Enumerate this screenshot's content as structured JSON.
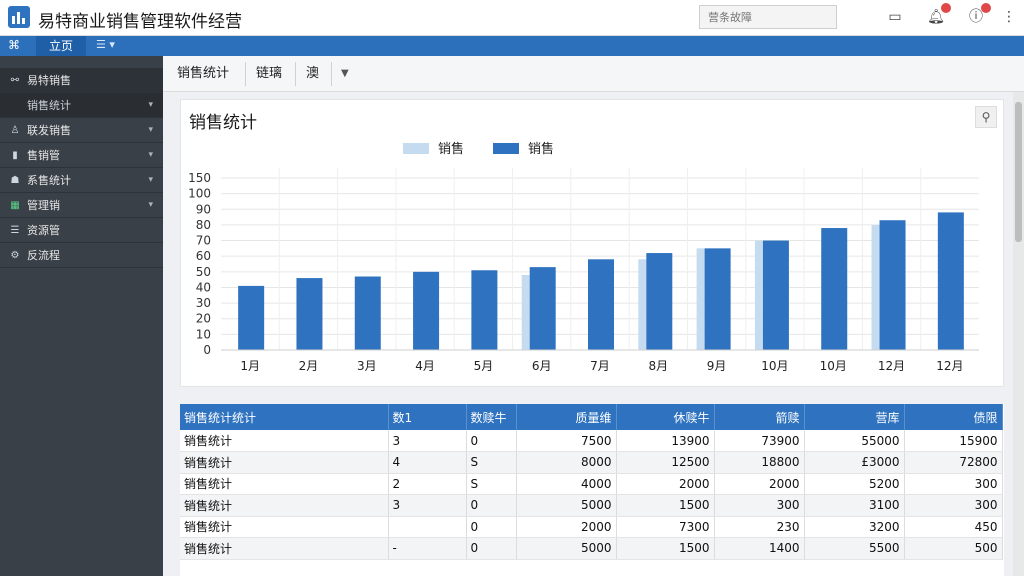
{
  "app": {
    "title": "易特商业销售管理软件经营"
  },
  "search": {
    "placeholder": "营条故障"
  },
  "nav": {
    "home_tab": "立页",
    "menu_label": "☰ ▾"
  },
  "sidebar": {
    "items": [
      {
        "label": "易特销售",
        "icon": "nodes-icon",
        "expandable": false,
        "active": true
      },
      {
        "label": "销售统计",
        "icon": "",
        "expandable": true,
        "sub": true
      },
      {
        "label": "联发销售",
        "icon": "user-icon",
        "expandable": true
      },
      {
        "label": "售销管",
        "icon": "tag-icon",
        "expandable": true
      },
      {
        "label": "系售统计",
        "icon": "people-icon",
        "expandable": true
      },
      {
        "label": "管理销",
        "icon": "grid-icon",
        "expandable": true
      },
      {
        "label": "资源管",
        "icon": "list-icon",
        "expandable": false
      },
      {
        "label": "反流程",
        "icon": "gear-icon",
        "expandable": false
      }
    ]
  },
  "toolbar": {
    "items": [
      "销售统计",
      "链璃",
      "澳"
    ]
  },
  "chart_panel": {
    "title": "销售统计"
  },
  "chart_data": {
    "type": "bar",
    "categories": [
      "1月",
      "2月",
      "3月",
      "4月",
      "5月",
      "6月",
      "7月",
      "8月",
      "9月",
      "10月",
      "10月",
      "12月",
      "12月"
    ],
    "series": [
      {
        "name": "销售",
        "color": "#c5dbef",
        "values": [
          null,
          null,
          null,
          null,
          null,
          48,
          null,
          58,
          65,
          70,
          null,
          80,
          null
        ]
      },
      {
        "name": "销售",
        "color": "#2f73c0",
        "values": [
          41,
          46,
          47,
          50,
          51,
          53,
          58,
          62,
          65,
          70,
          78,
          83,
          88
        ]
      }
    ],
    "ylim": [
      0,
      150
    ],
    "ticks": [
      0,
      10,
      20,
      30,
      40,
      50,
      60,
      70,
      80,
      90,
      100,
      150
    ],
    "grid": true,
    "legend": "top-center"
  },
  "table": {
    "headers": [
      "销售统计统计",
      "数1",
      "数赎牛",
      "质量维",
      "休赎牛",
      "箭赎",
      "营库",
      "债限"
    ],
    "rows": [
      [
        "销售统计",
        "3",
        "0",
        "7500",
        "13900",
        "73900",
        "55000",
        "15900"
      ],
      [
        "销售统计",
        "4",
        "S",
        "8000",
        "12500",
        "18800",
        "£3000",
        "72800"
      ],
      [
        "销售统计",
        "2",
        "S",
        "4000",
        "2000",
        "2000",
        "5200",
        "300"
      ],
      [
        "销售统计",
        "3",
        "0",
        "5000",
        "1500",
        "300",
        "3100",
        "300"
      ],
      [
        "销售统计",
        "",
        "0",
        "2000",
        "7300",
        "230",
        "3200",
        "450"
      ],
      [
        "销售统计",
        "-",
        "0",
        "5000",
        "1500",
        "1400",
        "5500",
        "500"
      ]
    ]
  },
  "colors": {
    "accent": "#2f73c0",
    "sidebar": "#3a4048",
    "bar_light": "#c5dbef"
  }
}
